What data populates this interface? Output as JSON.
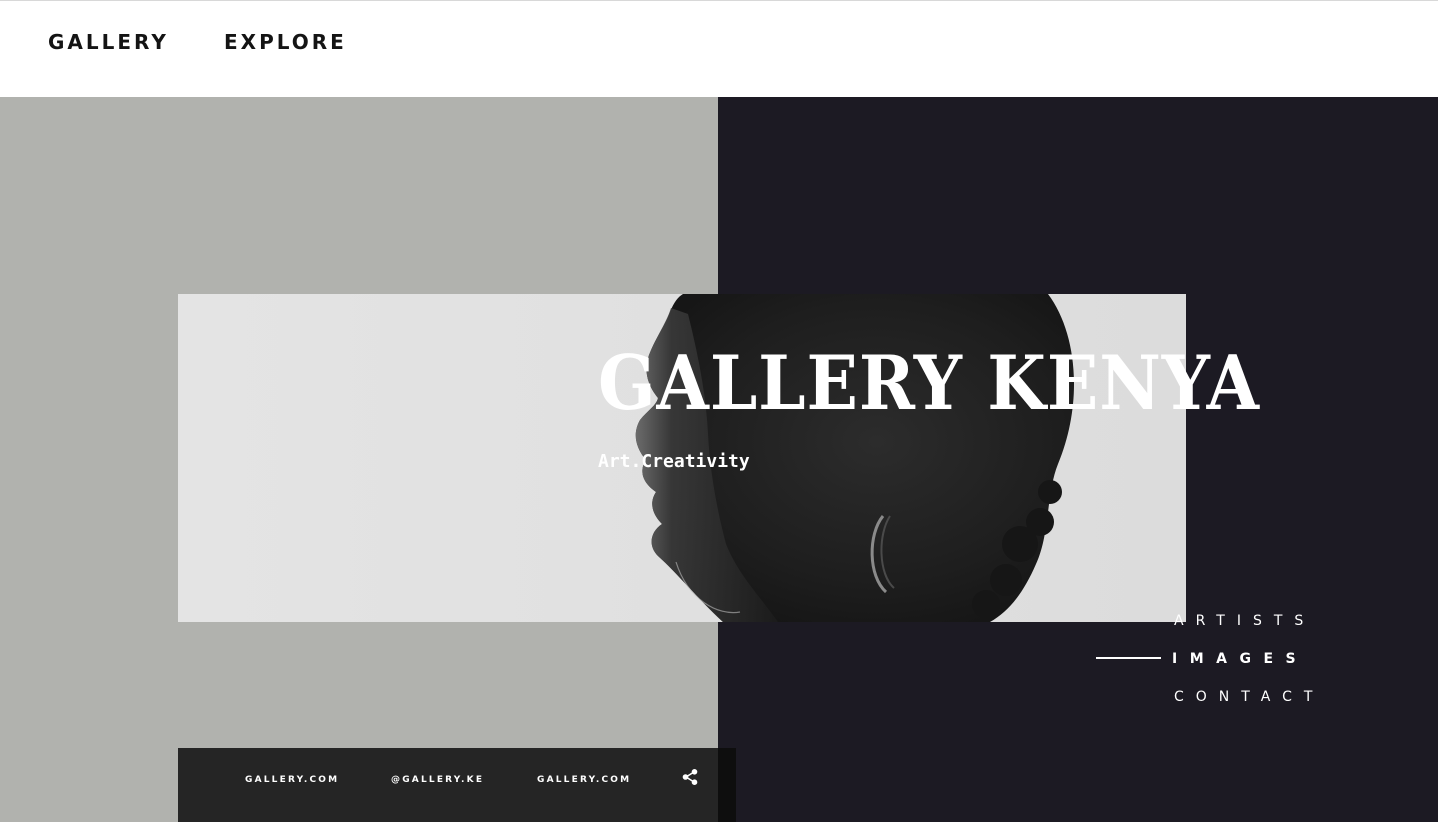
{
  "nav": {
    "gallery_label": "GALLERY",
    "explore_label": "EXPLORE"
  },
  "hero": {
    "title": "GALLERY KENYA",
    "subtitle": "Art.Creativity",
    "image": "portrait-photo"
  },
  "side_menu": {
    "items": [
      {
        "label": "ARTISTS",
        "active": false
      },
      {
        "label": "IMAGES",
        "active": true
      },
      {
        "label": "CONTACT",
        "active": false
      }
    ]
  },
  "footer": {
    "links": [
      "GALLERY.COM",
      "@GALLERY.KE",
      "GALLERY.COM"
    ],
    "share_icon": "share-icon"
  },
  "colors": {
    "left_panel": "#b1b2ae",
    "right_panel": "#1c1a23",
    "footer": "#252525",
    "text_light": "#ffffff",
    "text_dark": "#141414"
  }
}
